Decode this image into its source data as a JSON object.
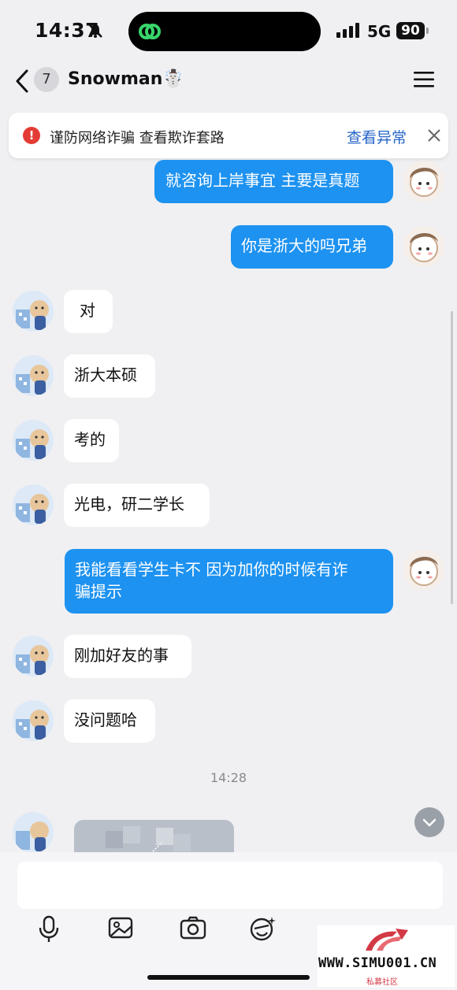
{
  "status_bar": {
    "time": "14:37",
    "network": "5G",
    "battery": "90"
  },
  "header": {
    "unread_count": "7",
    "title": "Snowman☃️"
  },
  "banner": {
    "text": "谨防网络诈骗 查看欺诈套路",
    "link": "查看异常"
  },
  "messages": [
    {
      "direction": "out",
      "text": "就咨询上岸事宜 主要是真题"
    },
    {
      "direction": "out",
      "text": "你是浙大的吗兄弟"
    },
    {
      "direction": "in",
      "text": "对"
    },
    {
      "direction": "in",
      "text": "浙大本硕"
    },
    {
      "direction": "in",
      "text": "考的"
    },
    {
      "direction": "in",
      "text": "光电，研二学长"
    },
    {
      "direction": "out",
      "text_line1": "我能看看学生卡不 因为加你的时候有诈",
      "text_line2": "骗提示"
    },
    {
      "direction": "in",
      "text": "刚加好友的事"
    },
    {
      "direction": "in",
      "text": "没问题哈"
    }
  ],
  "timestamp": "14:28",
  "input": {
    "placeholder": ""
  },
  "toolbar": [
    "microphone-icon",
    "image-icon",
    "camera-icon",
    "emoji-icon",
    "more-icon"
  ],
  "watermark": {
    "text": "WWW.SIMU001.CN",
    "sub": "私募社区"
  },
  "colors": {
    "outgoing_bubble": "#1d92f0",
    "background": "#f0f0f3",
    "warning": "#e43b35",
    "link": "#2565c7"
  }
}
